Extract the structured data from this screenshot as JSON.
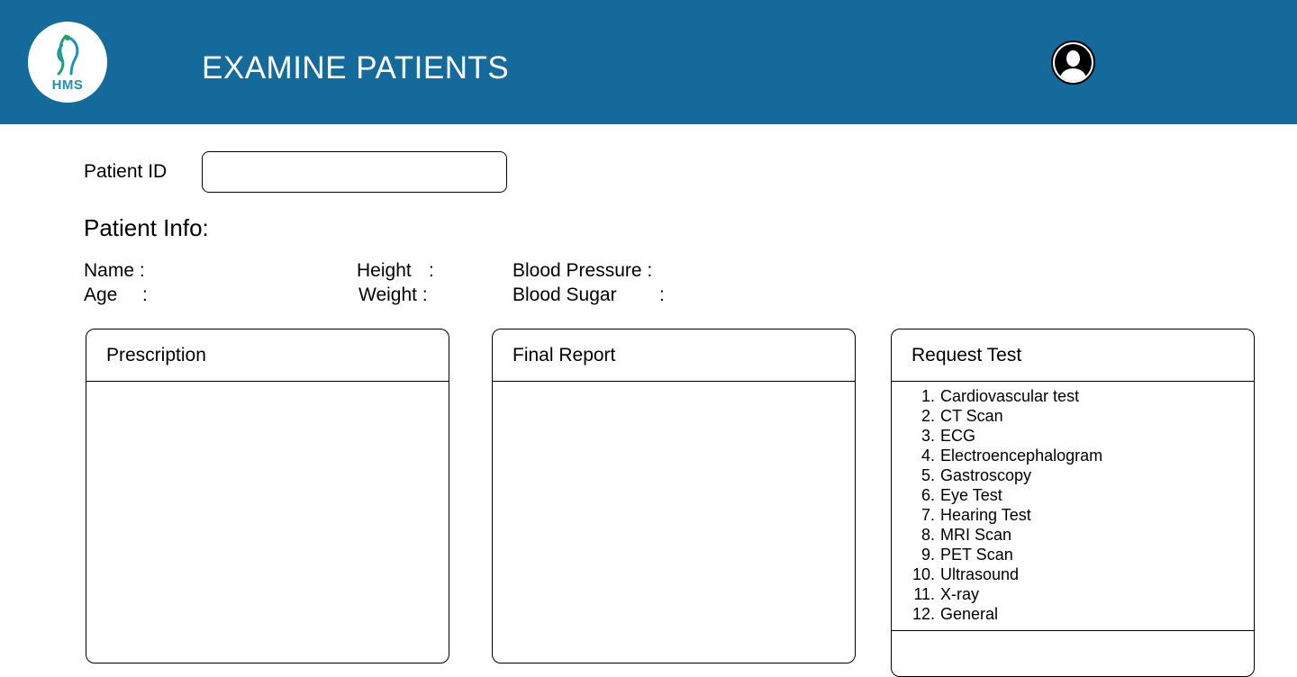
{
  "header": {
    "logo_text": "HMS",
    "title": "EXAMINE PATIENTS",
    "brand_color": "#136a9b"
  },
  "patient_id": {
    "label": "Patient ID",
    "value": "",
    "placeholder": ""
  },
  "patient_info": {
    "heading": "Patient Info:",
    "name_label": "Name :",
    "age_label": "Age",
    "height_label": "Height",
    "weight_label": "Weight :",
    "blood_pressure_label": "Blood Pressure :",
    "blood_sugar_label": "Blood Sugar",
    "colon": ":"
  },
  "prescription": {
    "title": "Prescription",
    "value": ""
  },
  "final_report": {
    "title": "Final Report",
    "value": ""
  },
  "request_test": {
    "title": "Request Test",
    "items": [
      {
        "num": "1.",
        "label": "Cardiovascular test"
      },
      {
        "num": "2.",
        "label": "CT Scan"
      },
      {
        "num": "3.",
        "label": "ECG"
      },
      {
        "num": "4.",
        "label": "Electroencephalogram"
      },
      {
        "num": "5.",
        "label": "Gastroscopy"
      },
      {
        "num": "6.",
        "label": "Eye Test"
      },
      {
        "num": "7.",
        "label": "Hearing Test"
      },
      {
        "num": "8.",
        "label": "MRI Scan"
      },
      {
        "num": "9.",
        "label": "PET Scan"
      },
      {
        "num": "10.",
        "label": "Ultrasound"
      },
      {
        "num": "11.",
        "label": "X-ray"
      },
      {
        "num": "12.",
        "label": "General"
      }
    ]
  }
}
